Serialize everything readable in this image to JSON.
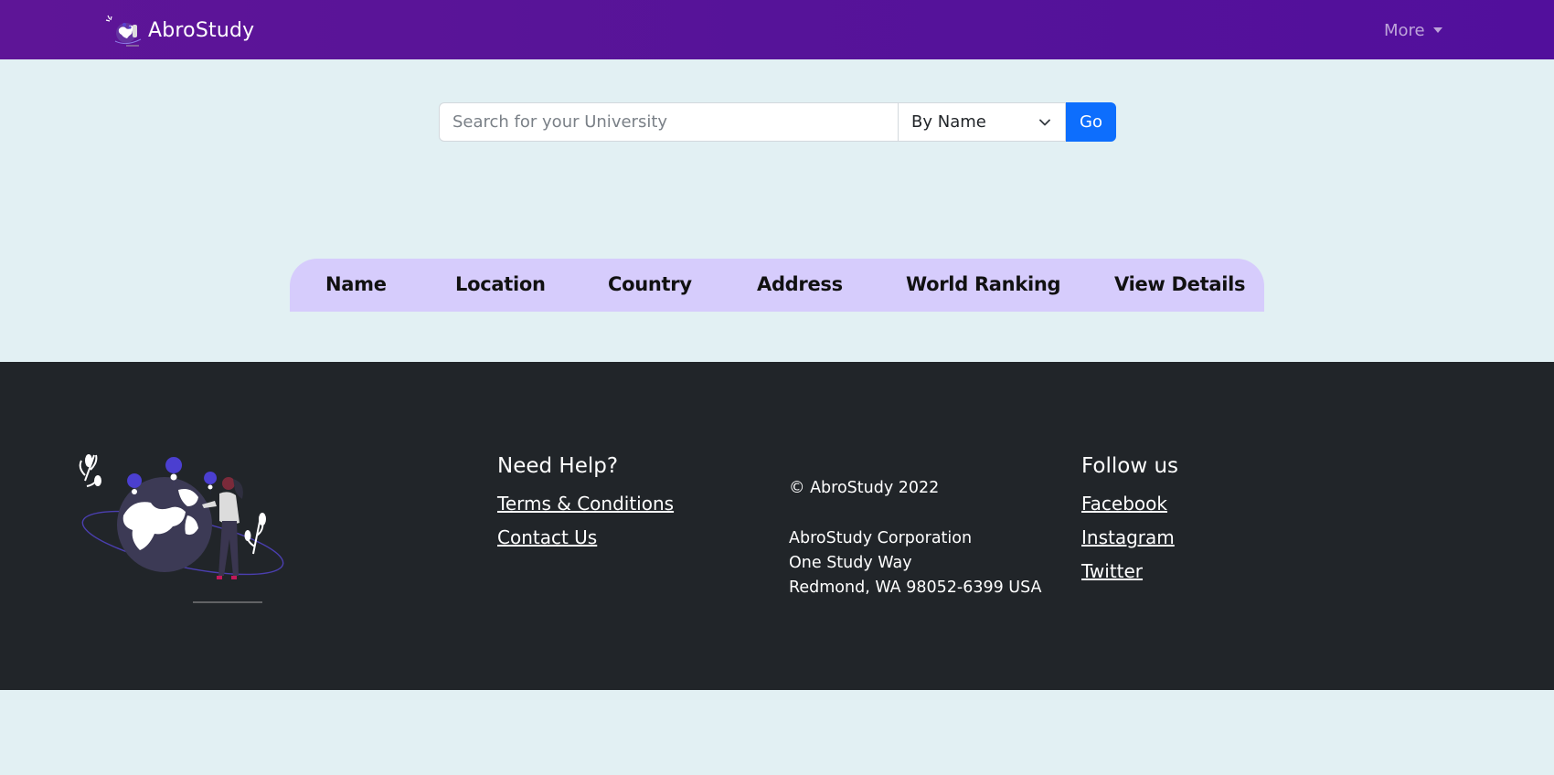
{
  "navbar": {
    "brand": "AbroStudy",
    "more_label": "More",
    "logo_icon": "globe-logo-icon",
    "colors": {
      "gradient_start": "#5e1597",
      "gradient_end": "#520f9c"
    }
  },
  "search": {
    "placeholder": "Search for your University",
    "value": "",
    "filter_selected": "By Name",
    "go_label": "Go"
  },
  "table": {
    "columns": [
      "Name",
      "Location",
      "Country",
      "Address",
      "World Ranking",
      "View Details"
    ],
    "header_color": "#d6ccfc"
  },
  "footer": {
    "help": {
      "title": "Need Help?",
      "links": [
        "Terms & Conditions",
        "Contact Us"
      ]
    },
    "info": {
      "copyright": "© AbroStudy 2022",
      "address_lines": [
        "AbroStudy Corporation",
        "One Study Way",
        "Redmond, WA 98052-6399 USA"
      ]
    },
    "social": {
      "title": "Follow us",
      "links": [
        "Facebook",
        "Instagram",
        "Twitter"
      ]
    },
    "illustration_icon": "world-travel-illustration",
    "background": "#212529"
  },
  "colors": {
    "page_bg": "#e2f0f3",
    "primary_button": "#0d6efd"
  }
}
